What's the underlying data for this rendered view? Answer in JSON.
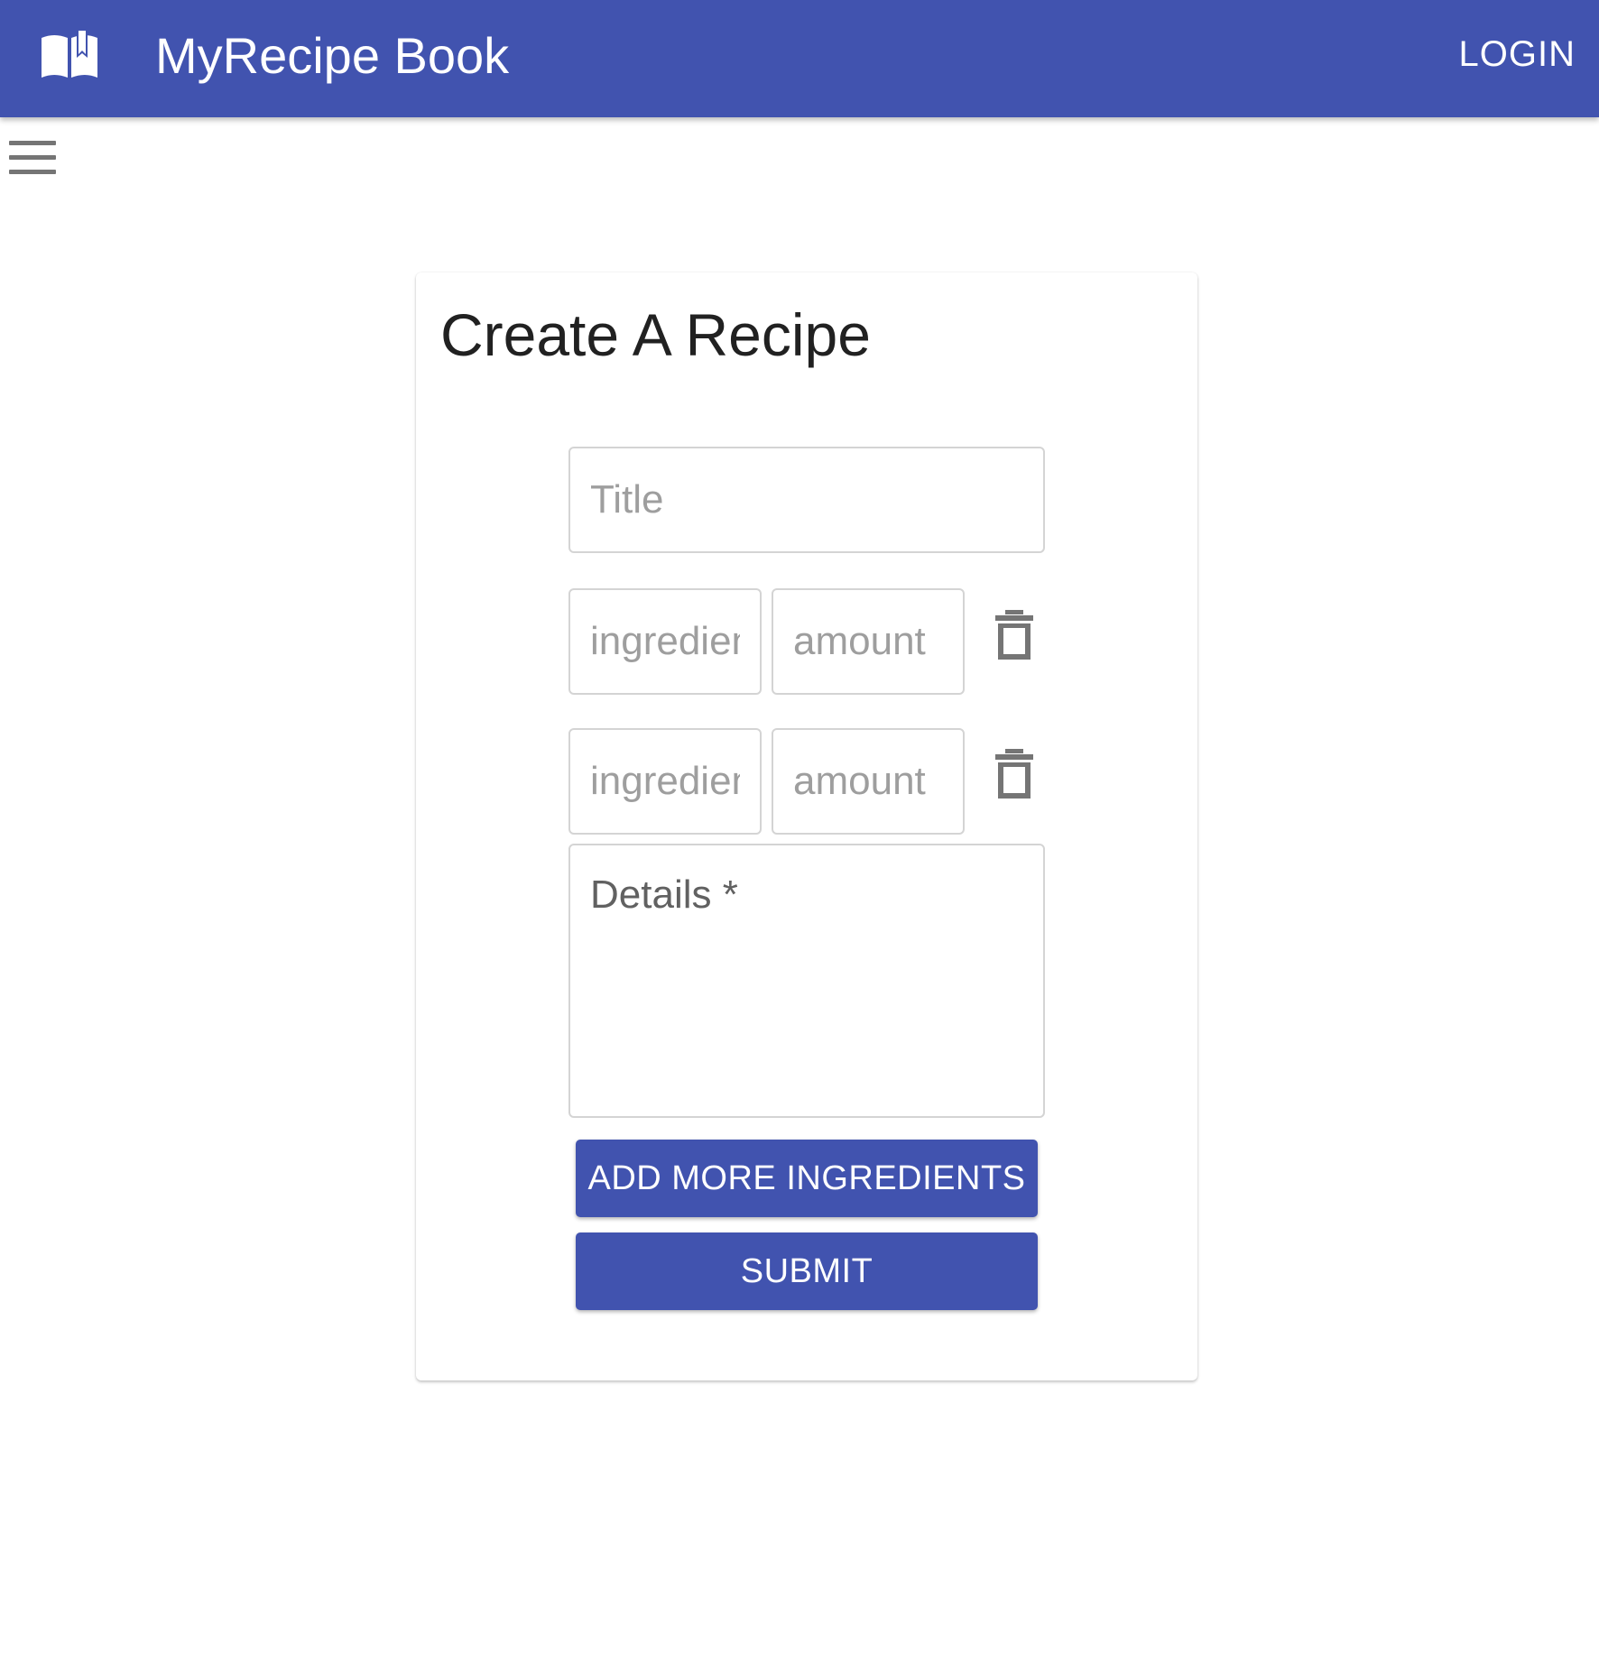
{
  "appbar": {
    "title": "MyRecipe Book",
    "login_label": "LOGIN",
    "logo_icon": "open-book-icon",
    "color": "#4153af"
  },
  "nav": {
    "menu_icon": "hamburger-menu-icon"
  },
  "form": {
    "heading": "Create A Recipe",
    "title_placeholder": "Title",
    "ingredients": [
      {
        "ingredient_placeholder": "ingredient",
        "amount_placeholder": "amount"
      },
      {
        "ingredient_placeholder": "ingredient",
        "amount_placeholder": "amount"
      }
    ],
    "delete_icon": "trash-icon",
    "details_label": "Details *",
    "add_button_label": "ADD MORE INGREDIENTS",
    "submit_button_label": "SUBMIT"
  }
}
